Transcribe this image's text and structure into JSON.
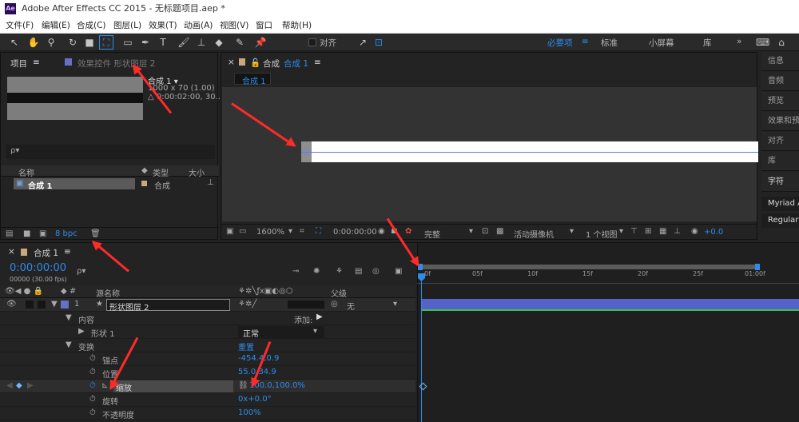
{
  "title": {
    "icon": "Ae",
    "text": "Adobe After Effects CC 2015 - 无标题项目.aep *"
  },
  "menu": [
    "文件(F)",
    "编辑(E)",
    "合成(C)",
    "图层(L)",
    "效果(T)",
    "动画(A)",
    "视图(V)",
    "窗口",
    "帮助(H)"
  ],
  "toolbar": {
    "align": "对齐",
    "workspaces": [
      "必要项",
      "标准",
      "小屏幕",
      "库"
    ],
    "more": "»"
  },
  "project": {
    "tab": "项目",
    "effects_tab": "效果控件 形状图层 2",
    "comp_name": "合成 1 ▾",
    "comp_size": "1000 x 70 (1.00)",
    "comp_dur": "△ 0:00:02:00, 30...",
    "col_name": "名称",
    "col_type": "类型",
    "col_size": "大小",
    "item_name": "合成 1",
    "item_type": "合成",
    "bpc": "8 bpc"
  },
  "comp": {
    "tab": "合成",
    "tab_name": "合成 1",
    "badge": "合成 1",
    "zoom": "1600%",
    "time": "0:00:00:00",
    "quality": "完整",
    "camera": "活动摄像机",
    "views": "1 个视图",
    "exposure": "+0.0"
  },
  "right": [
    "信息",
    "音频",
    "预览",
    "效果和预设",
    "对齐",
    "库",
    "字符"
  ],
  "font": {
    "name": "Myriad A",
    "style": "Regular"
  },
  "timeline": {
    "tab": "合成 1",
    "time": "0:00:00:00",
    "fps": "00000 (30.00 fps)",
    "search": "ρ▾",
    "col_source": "源名称",
    "col_parent": "父级",
    "layer_num": "1",
    "layer_name": "形状图层 2",
    "parent": "无",
    "contents": "内容",
    "add": "添加:",
    "shape": "形状 1",
    "mode": "正常",
    "transform": "变换",
    "reset": "重置",
    "props": [
      {
        "name": "锚点",
        "value": "-454.4,0.9"
      },
      {
        "name": "位置",
        "value": "55.0,34.9"
      },
      {
        "name": "缩放",
        "value": "100.0,100.0%"
      },
      {
        "name": "旋转",
        "value": "0x+0.0°"
      },
      {
        "name": "不透明度",
        "value": "100%"
      }
    ],
    "ruler": [
      "0f",
      "05f",
      "10f",
      "15f",
      "20f",
      "25f",
      "01:00f"
    ]
  }
}
